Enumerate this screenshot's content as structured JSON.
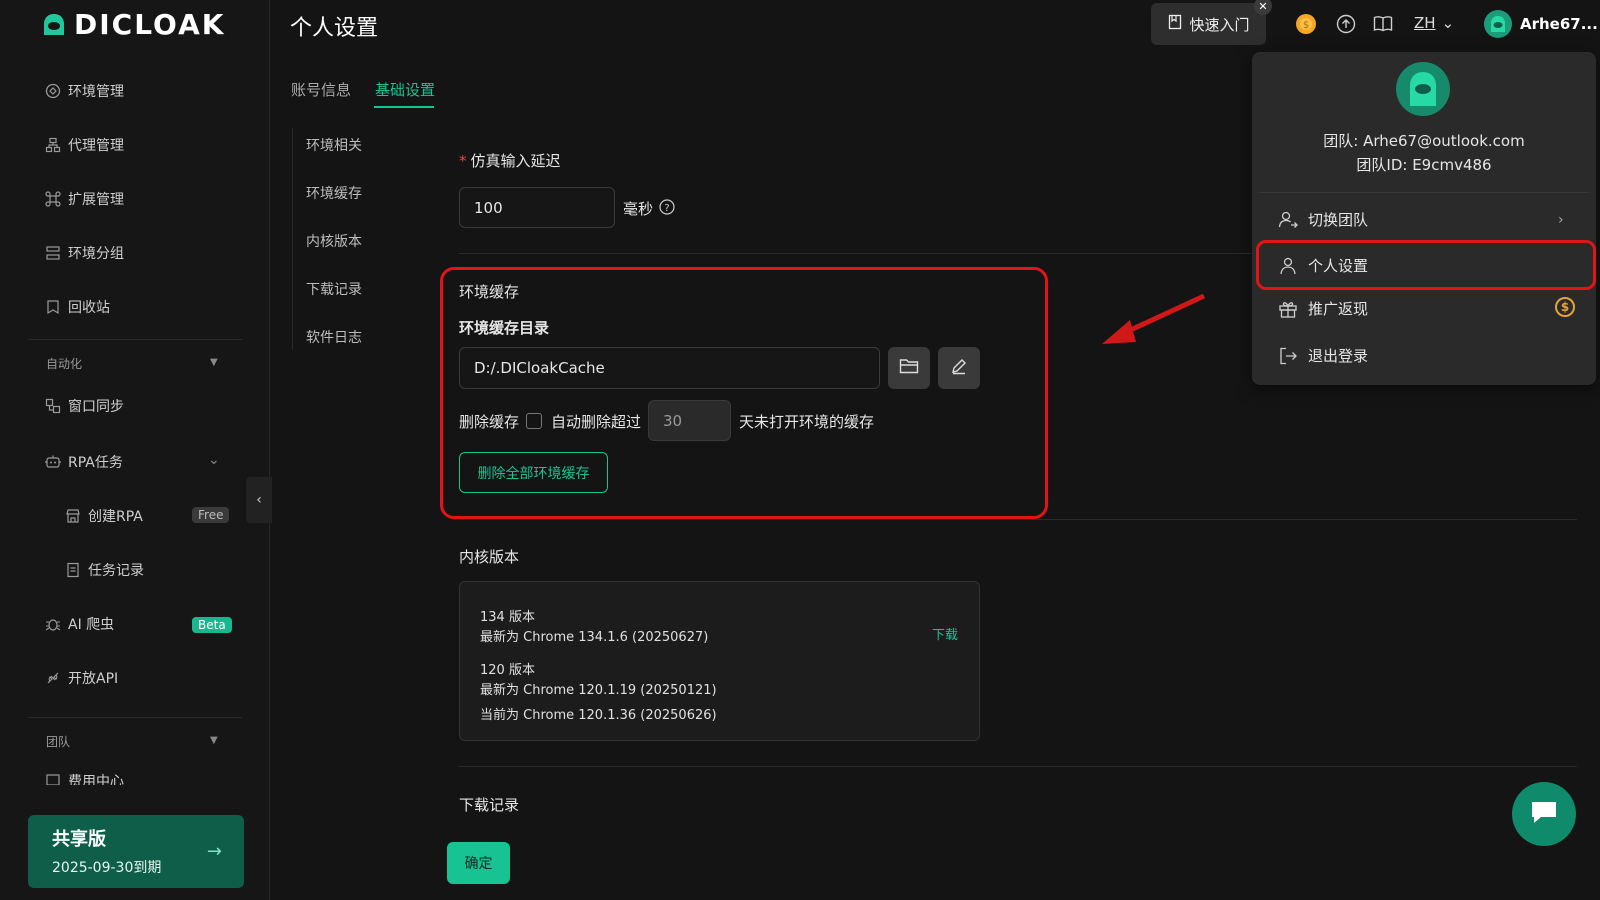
{
  "brand": {
    "name": "DICLOAK"
  },
  "sidebar": {
    "items": [
      {
        "label": "环境管理",
        "icon": "environment-icon"
      },
      {
        "label": "代理管理",
        "icon": "proxy-icon"
      },
      {
        "label": "扩展管理",
        "icon": "extension-icon"
      },
      {
        "label": "环境分组",
        "icon": "group-icon"
      },
      {
        "label": "回收站",
        "icon": "recycle-icon"
      }
    ],
    "automation_label": "自动化",
    "automation_items": [
      {
        "label": "窗口同步",
        "icon": "sync-icon"
      },
      {
        "label": "RPA任务",
        "icon": "robot-icon"
      },
      {
        "label": "创建RPA",
        "icon": "store-icon",
        "badge": "Free"
      },
      {
        "label": "任务记录",
        "icon": "doc-icon"
      },
      {
        "label": "AI 爬虫",
        "icon": "bug-icon",
        "badge": "Beta"
      },
      {
        "label": "开放API",
        "icon": "api-icon"
      }
    ],
    "team_label": "团队",
    "team_partial": "费用中心",
    "plan": {
      "title": "共享版",
      "expiry": "2025-09-30到期"
    }
  },
  "header": {
    "title": "个人设置",
    "quick_start": "快速入门",
    "lang": "ZH",
    "username": "Arhe67..."
  },
  "tabs": [
    {
      "label": "账号信息"
    },
    {
      "label": "基础设置"
    }
  ],
  "subnav": [
    "环境相关",
    "环境缓存",
    "内核版本",
    "下载记录",
    "软件日志"
  ],
  "input_delay": {
    "label": "仿真输入延迟",
    "value": "100",
    "unit": "毫秒"
  },
  "cache": {
    "title": "环境缓存",
    "dir_label": "环境缓存目录",
    "dir_value": "D:/.DICloakCache",
    "delete_label": "删除缓存",
    "auto_delete_label": "自动删除超过",
    "days_value": "30",
    "days_suffix": "天未打开环境的缓存",
    "delete_all_button": "删除全部环境缓存"
  },
  "kernel": {
    "title": "内核版本",
    "v134_title": "134 版本",
    "v134_latest": "最新为 Chrome 134.1.6 (20250627)",
    "download": "下载",
    "v120_title": "120 版本",
    "v120_latest": "最新为 Chrome 120.1.19 (20250121)",
    "v120_current": "当前为 Chrome 120.1.36 (20250626)"
  },
  "downloads": {
    "title": "下载记录"
  },
  "confirm_button": "确定",
  "dropdown": {
    "team": "团队: Arhe67@outlook.com",
    "team_id": "团队ID: E9cmv486",
    "items": [
      "切换团队",
      "个人设置",
      "推广返现",
      "退出登录"
    ]
  },
  "colors": {
    "accent": "#17c392",
    "highlight": "#e01616",
    "coin": "#e6a23c"
  }
}
